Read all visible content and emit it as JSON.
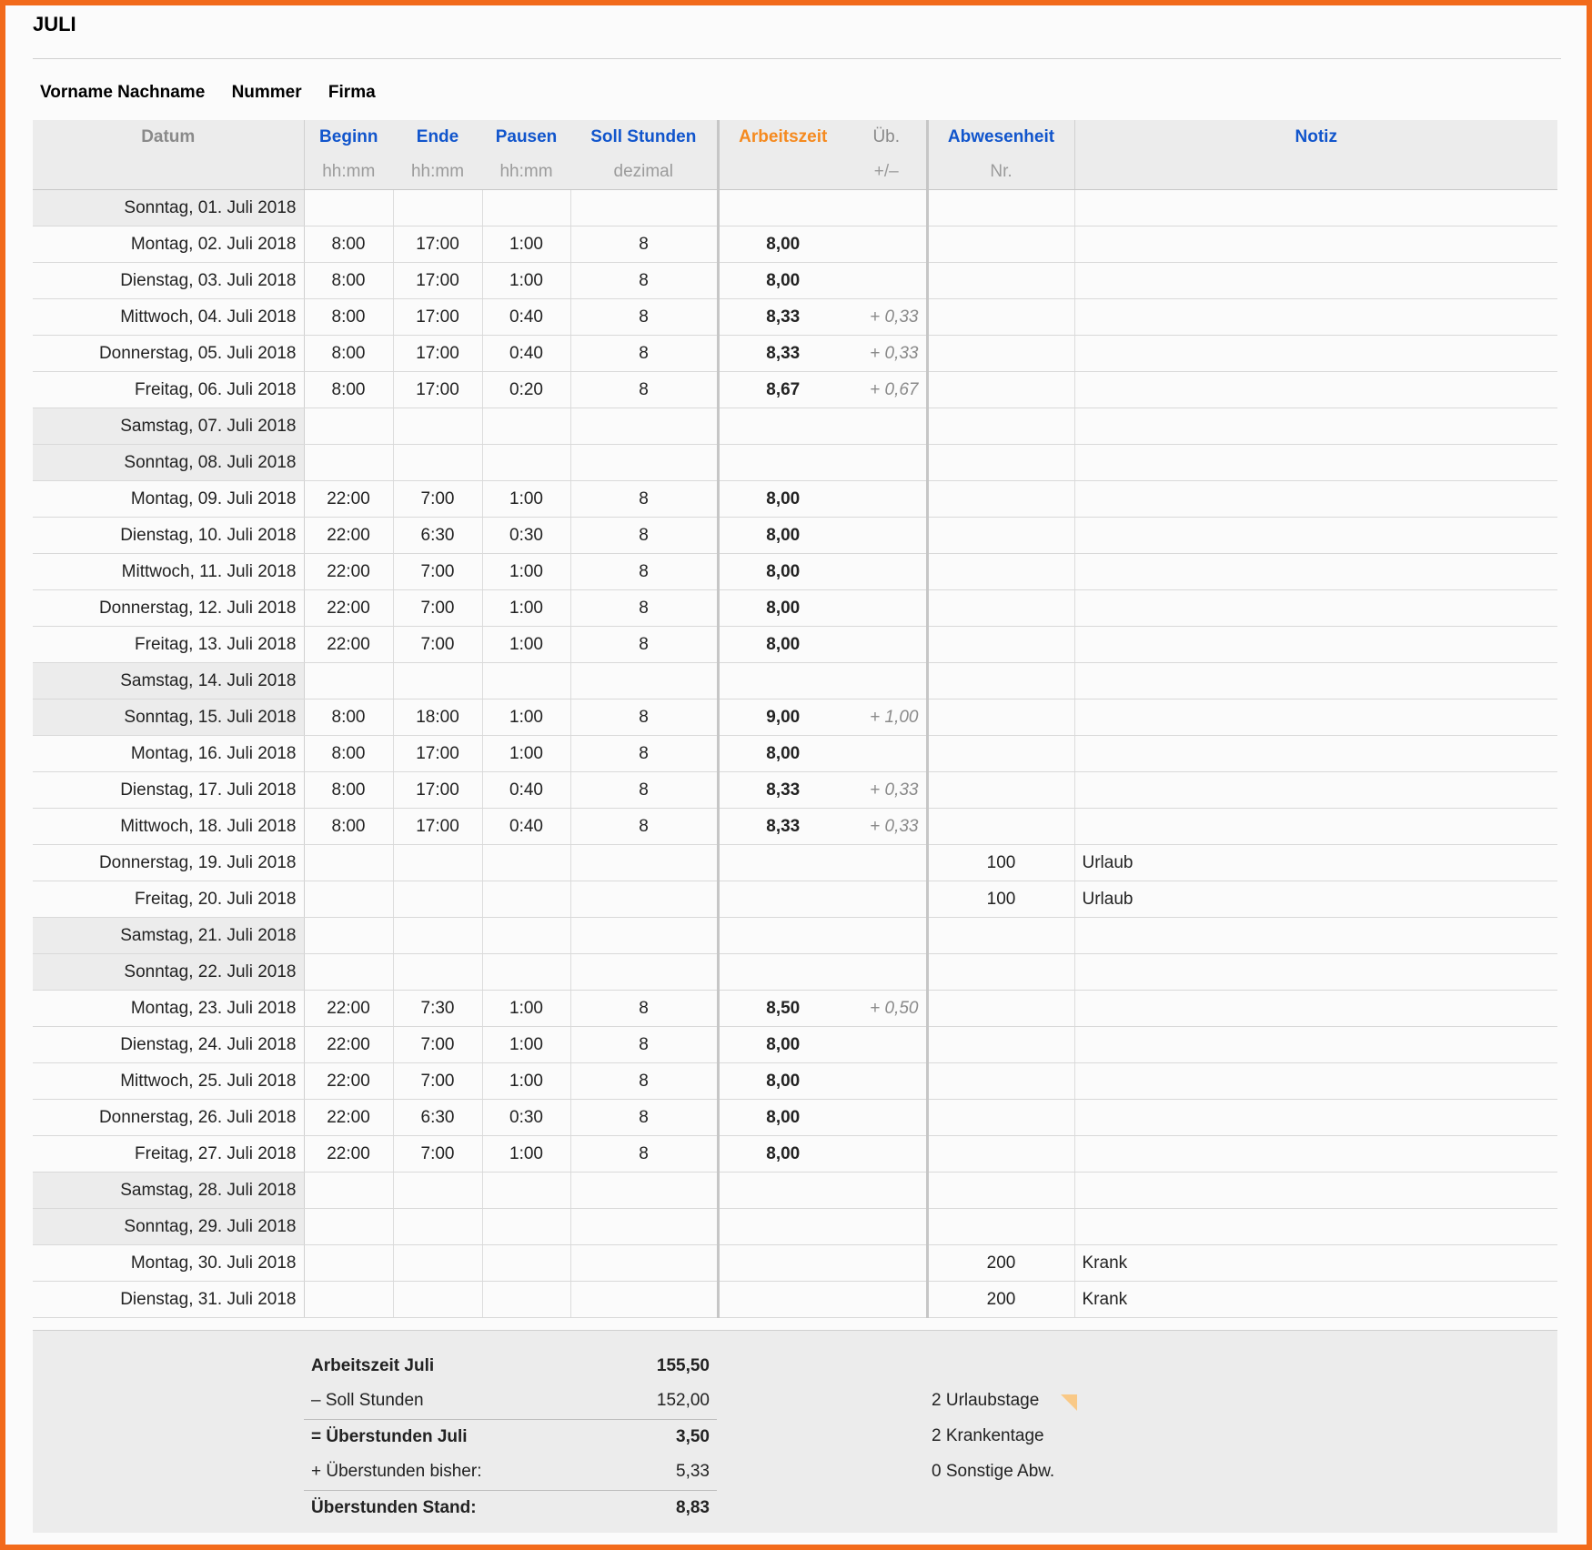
{
  "title": "JULI",
  "meta": {
    "name": "Vorname Nachname",
    "number": "Nummer",
    "company": "Firma"
  },
  "headers": {
    "datum": "Datum",
    "beginn": "Beginn",
    "ende": "Ende",
    "pausen": "Pausen",
    "soll": "Soll Stunden",
    "arbeitszeit": "Arbeitszeit",
    "ueb": "Üb.",
    "abwesenheit": "Abwesenheit",
    "notiz": "Notiz",
    "beginn_unit": "hh:mm",
    "ende_unit": "hh:mm",
    "pausen_unit": "hh:mm",
    "soll_unit": "dezimal",
    "ueb_unit": "+/–",
    "abw_unit": "Nr."
  },
  "rows": [
    {
      "date": "Sonntag, 01. Juli 2018",
      "weekend": true,
      "begin": "",
      "end": "",
      "pause": "",
      "soll": "",
      "az": "",
      "ue": "",
      "abw": "",
      "note": ""
    },
    {
      "date": "Montag, 02. Juli 2018",
      "weekend": false,
      "begin": "8:00",
      "end": "17:00",
      "pause": "1:00",
      "soll": "8",
      "az": "8,00",
      "ue": "",
      "abw": "",
      "note": ""
    },
    {
      "date": "Dienstag, 03. Juli 2018",
      "weekend": false,
      "begin": "8:00",
      "end": "17:00",
      "pause": "1:00",
      "soll": "8",
      "az": "8,00",
      "ue": "",
      "abw": "",
      "note": ""
    },
    {
      "date": "Mittwoch, 04. Juli 2018",
      "weekend": false,
      "begin": "8:00",
      "end": "17:00",
      "pause": "0:40",
      "soll": "8",
      "az": "8,33",
      "ue": "+ 0,33",
      "abw": "",
      "note": ""
    },
    {
      "date": "Donnerstag, 05. Juli 2018",
      "weekend": false,
      "begin": "8:00",
      "end": "17:00",
      "pause": "0:40",
      "soll": "8",
      "az": "8,33",
      "ue": "+ 0,33",
      "abw": "",
      "note": ""
    },
    {
      "date": "Freitag, 06. Juli 2018",
      "weekend": false,
      "begin": "8:00",
      "end": "17:00",
      "pause": "0:20",
      "soll": "8",
      "az": "8,67",
      "ue": "+ 0,67",
      "abw": "",
      "note": ""
    },
    {
      "date": "Samstag, 07. Juli 2018",
      "weekend": true,
      "begin": "",
      "end": "",
      "pause": "",
      "soll": "",
      "az": "",
      "ue": "",
      "abw": "",
      "note": ""
    },
    {
      "date": "Sonntag, 08. Juli 2018",
      "weekend": true,
      "begin": "",
      "end": "",
      "pause": "",
      "soll": "",
      "az": "",
      "ue": "",
      "abw": "",
      "note": ""
    },
    {
      "date": "Montag, 09. Juli 2018",
      "weekend": false,
      "begin": "22:00",
      "end": "7:00",
      "pause": "1:00",
      "soll": "8",
      "az": "8,00",
      "ue": "",
      "abw": "",
      "note": ""
    },
    {
      "date": "Dienstag, 10. Juli 2018",
      "weekend": false,
      "begin": "22:00",
      "end": "6:30",
      "pause": "0:30",
      "soll": "8",
      "az": "8,00",
      "ue": "",
      "abw": "",
      "note": ""
    },
    {
      "date": "Mittwoch, 11. Juli 2018",
      "weekend": false,
      "begin": "22:00",
      "end": "7:00",
      "pause": "1:00",
      "soll": "8",
      "az": "8,00",
      "ue": "",
      "abw": "",
      "note": ""
    },
    {
      "date": "Donnerstag, 12. Juli 2018",
      "weekend": false,
      "begin": "22:00",
      "end": "7:00",
      "pause": "1:00",
      "soll": "8",
      "az": "8,00",
      "ue": "",
      "abw": "",
      "note": ""
    },
    {
      "date": "Freitag, 13. Juli 2018",
      "weekend": false,
      "begin": "22:00",
      "end": "7:00",
      "pause": "1:00",
      "soll": "8",
      "az": "8,00",
      "ue": "",
      "abw": "",
      "note": ""
    },
    {
      "date": "Samstag, 14. Juli 2018",
      "weekend": true,
      "begin": "",
      "end": "",
      "pause": "",
      "soll": "",
      "az": "",
      "ue": "",
      "abw": "",
      "note": ""
    },
    {
      "date": "Sonntag, 15. Juli 2018",
      "weekend": true,
      "begin": "8:00",
      "end": "18:00",
      "pause": "1:00",
      "soll": "8",
      "az": "9,00",
      "ue": "+ 1,00",
      "abw": "",
      "note": ""
    },
    {
      "date": "Montag, 16. Juli 2018",
      "weekend": false,
      "begin": "8:00",
      "end": "17:00",
      "pause": "1:00",
      "soll": "8",
      "az": "8,00",
      "ue": "",
      "abw": "",
      "note": ""
    },
    {
      "date": "Dienstag, 17. Juli 2018",
      "weekend": false,
      "begin": "8:00",
      "end": "17:00",
      "pause": "0:40",
      "soll": "8",
      "az": "8,33",
      "ue": "+ 0,33",
      "abw": "",
      "note": ""
    },
    {
      "date": "Mittwoch, 18. Juli 2018",
      "weekend": false,
      "begin": "8:00",
      "end": "17:00",
      "pause": "0:40",
      "soll": "8",
      "az": "8,33",
      "ue": "+ 0,33",
      "abw": "",
      "note": ""
    },
    {
      "date": "Donnerstag, 19. Juli 2018",
      "weekend": false,
      "begin": "",
      "end": "",
      "pause": "",
      "soll": "",
      "az": "",
      "ue": "",
      "abw": "100",
      "note": "Urlaub"
    },
    {
      "date": "Freitag, 20. Juli 2018",
      "weekend": false,
      "begin": "",
      "end": "",
      "pause": "",
      "soll": "",
      "az": "",
      "ue": "",
      "abw": "100",
      "note": "Urlaub"
    },
    {
      "date": "Samstag, 21. Juli 2018",
      "weekend": true,
      "begin": "",
      "end": "",
      "pause": "",
      "soll": "",
      "az": "",
      "ue": "",
      "abw": "",
      "note": ""
    },
    {
      "date": "Sonntag, 22. Juli 2018",
      "weekend": true,
      "begin": "",
      "end": "",
      "pause": "",
      "soll": "",
      "az": "",
      "ue": "",
      "abw": "",
      "note": ""
    },
    {
      "date": "Montag, 23. Juli 2018",
      "weekend": false,
      "begin": "22:00",
      "end": "7:30",
      "pause": "1:00",
      "soll": "8",
      "az": "8,50",
      "ue": "+ 0,50",
      "abw": "",
      "note": ""
    },
    {
      "date": "Dienstag, 24. Juli 2018",
      "weekend": false,
      "begin": "22:00",
      "end": "7:00",
      "pause": "1:00",
      "soll": "8",
      "az": "8,00",
      "ue": "",
      "abw": "",
      "note": ""
    },
    {
      "date": "Mittwoch, 25. Juli 2018",
      "weekend": false,
      "begin": "22:00",
      "end": "7:00",
      "pause": "1:00",
      "soll": "8",
      "az": "8,00",
      "ue": "",
      "abw": "",
      "note": ""
    },
    {
      "date": "Donnerstag, 26. Juli 2018",
      "weekend": false,
      "begin": "22:00",
      "end": "6:30",
      "pause": "0:30",
      "soll": "8",
      "az": "8,00",
      "ue": "",
      "abw": "",
      "note": ""
    },
    {
      "date": "Freitag, 27. Juli 2018",
      "weekend": false,
      "begin": "22:00",
      "end": "7:00",
      "pause": "1:00",
      "soll": "8",
      "az": "8,00",
      "ue": "",
      "abw": "",
      "note": ""
    },
    {
      "date": "Samstag, 28. Juli 2018",
      "weekend": true,
      "begin": "",
      "end": "",
      "pause": "",
      "soll": "",
      "az": "",
      "ue": "",
      "abw": "",
      "note": ""
    },
    {
      "date": "Sonntag, 29. Juli 2018",
      "weekend": true,
      "begin": "",
      "end": "",
      "pause": "",
      "soll": "",
      "az": "",
      "ue": "",
      "abw": "",
      "note": ""
    },
    {
      "date": "Montag, 30. Juli 2018",
      "weekend": false,
      "begin": "",
      "end": "",
      "pause": "",
      "soll": "",
      "az": "",
      "ue": "",
      "abw": "200",
      "note": "Krank"
    },
    {
      "date": "Dienstag, 31. Juli 2018",
      "weekend": false,
      "begin": "",
      "end": "",
      "pause": "",
      "soll": "",
      "az": "",
      "ue": "",
      "abw": "200",
      "note": "Krank"
    }
  ],
  "summary": {
    "arbeitszeit_label": "Arbeitszeit Juli",
    "arbeitszeit_value": "155,50",
    "soll_label": "– Soll Stunden",
    "soll_value": "152,00",
    "ueberstunden_label": "= Überstunden Juli",
    "ueberstunden_value": "3,50",
    "bisher_label": "+ Überstunden bisher:",
    "bisher_value": "5,33",
    "stand_label": "Überstunden Stand:",
    "stand_value": "8,83",
    "urlaub": "2 Urlaubstage",
    "krank": "2 Krankentage",
    "sonstige": "0 Sonstige Abw."
  },
  "colors": {
    "accent_blue": "#1155cc",
    "accent_orange": "#f58a1f",
    "border_orange": "#f26a1b"
  }
}
